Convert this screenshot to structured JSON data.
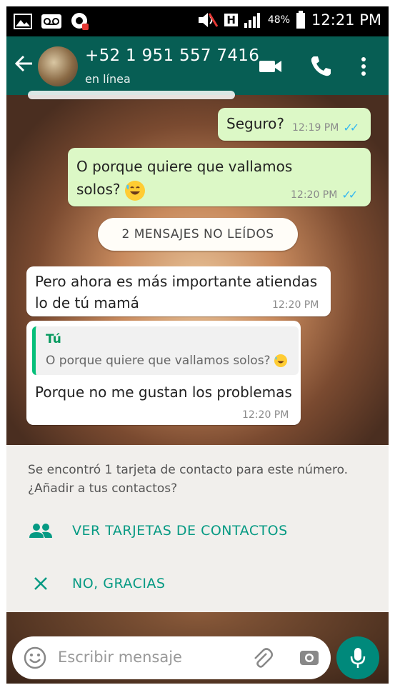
{
  "status_bar": {
    "battery": "48%",
    "time": "12:21 PM",
    "network_letter": "H"
  },
  "header": {
    "contact_name": "+52 1 951 557 7416",
    "status": "en línea"
  },
  "messages": [
    {
      "direction": "out",
      "text": "Seguro?",
      "time": "12:19 PM",
      "read": true
    },
    {
      "direction": "out",
      "text_line1": "O porque quiere que vallamos",
      "text_line2": "solos?",
      "time": "12:20 PM",
      "read": true
    },
    {
      "direction": "in",
      "text_line1": "Pero ahora es más importante atiendas",
      "text_line2": "lo de tú mamá",
      "time": "12:20 PM"
    },
    {
      "direction": "in",
      "quote_author": "Tú",
      "quote_text": "O porque quiere que vallamos solos?",
      "text": "Porque no me gustan los problemas",
      "time": "12:20 PM"
    }
  ],
  "unread_divider": "2 MENSAJES NO LEÍDOS",
  "contact_card": {
    "text": "Se encontró 1 tarjeta de contacto para este número. ¿Añadir a tus contactos?",
    "view_action": "VER TARJETAS DE CONTACTOS",
    "dismiss_action": "NO, GRACIAS"
  },
  "composer": {
    "placeholder": "Escribir mensaje"
  },
  "colors": {
    "app_bar": "#075e54",
    "outgoing_bubble": "#dcf8c6",
    "accent": "#069a83",
    "read_ticks": "#34b7f1"
  }
}
